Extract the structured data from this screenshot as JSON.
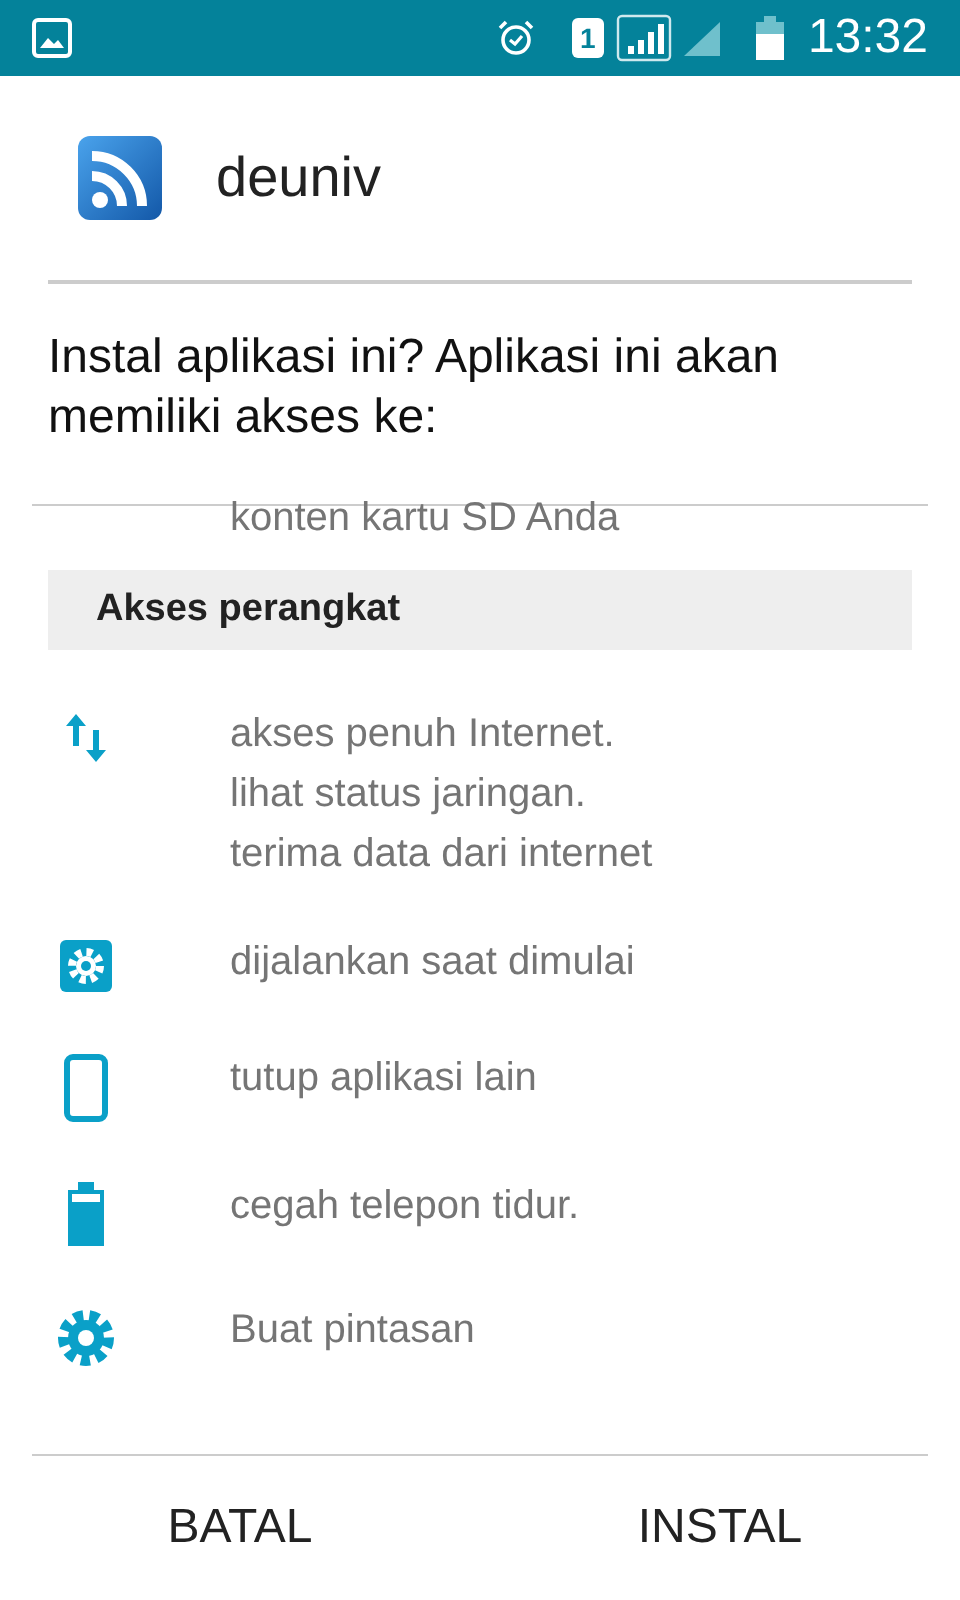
{
  "status_bar": {
    "time": "13:32",
    "sim": "1"
  },
  "app": {
    "name": "deuniv"
  },
  "prompt": "Instal aplikasi ini? Aplikasi ini akan memiliki akses ke:",
  "partial_line": "konten kartu SD Anda",
  "section": {
    "title": "Akses perangkat"
  },
  "permissions": [
    {
      "kind": "network",
      "lines": [
        "akses penuh Internet.",
        "lihat status jaringan.",
        "terima data dari internet"
      ]
    },
    {
      "kind": "startup",
      "lines": [
        "dijalankan saat dimulai"
      ]
    },
    {
      "kind": "phone",
      "lines": [
        "tutup aplikasi lain"
      ]
    },
    {
      "kind": "battery",
      "lines": [
        "cegah telepon tidur."
      ]
    },
    {
      "kind": "gear",
      "lines": [
        "Buat pintasan"
      ]
    }
  ],
  "buttons": [
    {
      "label": "BATAL"
    },
    {
      "label": "INSTAL"
    }
  ]
}
